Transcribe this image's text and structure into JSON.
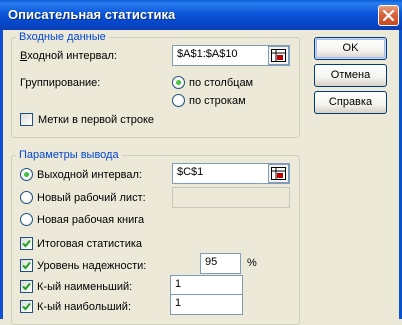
{
  "window": {
    "title": "Описательная статистика"
  },
  "input_group": {
    "title": "Входные данные",
    "range_label": "Входной интервал:",
    "range_value": "$A$1:$A$10",
    "grouping_label": "Группирование:",
    "by_columns": "по столбцам",
    "by_rows": "по строкам",
    "labels_first_row": "Метки в первой строке"
  },
  "buttons": {
    "ok": "OK",
    "cancel": "Отмена",
    "help": "Справка"
  },
  "output_group": {
    "title": "Параметры вывода",
    "output_range_label": "Выходной интервал:",
    "output_range_value": "$C$1",
    "new_sheet_label": "Новый рабочий лист:",
    "new_sheet_value": "",
    "new_workbook_label": "Новая рабочая книга",
    "summary_stats": "Итоговая статистика",
    "confidence_label": "Уровень надежности:",
    "confidence_value": "95",
    "percent_sign": "%",
    "kth_smallest_label": "К-ый наименьший:",
    "kth_smallest_value": "1",
    "kth_largest_label": "К-ый наибольший:",
    "kth_largest_value": "1"
  }
}
